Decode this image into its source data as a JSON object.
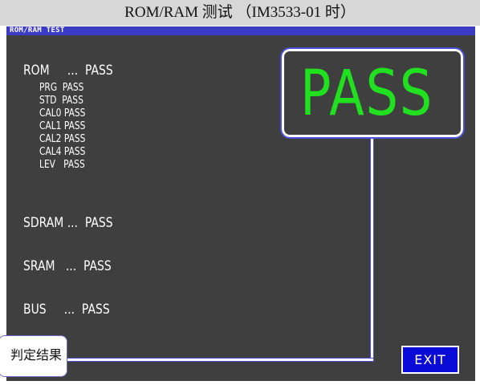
{
  "caption": "ROM/RAM 测试 （IM3533-01 时）",
  "screen_title": "ROM/RAM TEST",
  "results": {
    "rom": "ROM     ...  PASS",
    "rom_items": [
      "PRG  PASS",
      "STD  PASS",
      "CAL0 PASS",
      "CAL1 PASS",
      "CAL2 PASS",
      "CAL4 PASS",
      "LEV   PASS"
    ],
    "sdram": "SDRAM ...  PASS",
    "sram": "SRAM   ...  PASS",
    "bus": "BUS     ...  PASS"
  },
  "judgement": {
    "value": "PASS",
    "color": "#20e020"
  },
  "callout": "判定结果",
  "exit_label": "EXIT",
  "colors": {
    "screen_bg": "#3f3f3f",
    "title_bar": "#3b3bc6",
    "button": "#0b0bd8",
    "accent_outline": "#4d4dd6"
  }
}
